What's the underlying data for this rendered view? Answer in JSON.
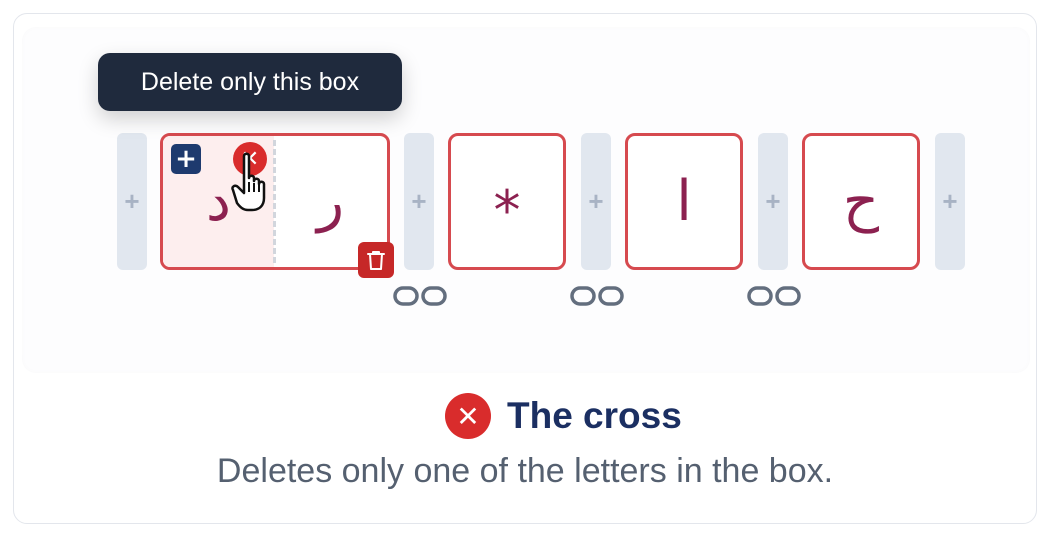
{
  "tooltip": {
    "text": "Delete only this box"
  },
  "boxes": [
    {
      "letter_left": "د",
      "letter_right": "ر"
    },
    {
      "letter": "*"
    },
    {
      "letter": "ا"
    },
    {
      "letter": "ح"
    }
  ],
  "slot_label": "+",
  "legend": {
    "title": "The cross",
    "description": "Deletes only one of the letters in the box."
  },
  "colors": {
    "accent_red": "#d92c2c",
    "box_border": "#d64a4f",
    "letter": "#8c2150",
    "navy": "#1b2f62",
    "slot": "#e1e7ef"
  },
  "icons": [
    "plus-icon",
    "close-icon",
    "trash-icon",
    "link-icon",
    "hand-pointer-icon"
  ]
}
